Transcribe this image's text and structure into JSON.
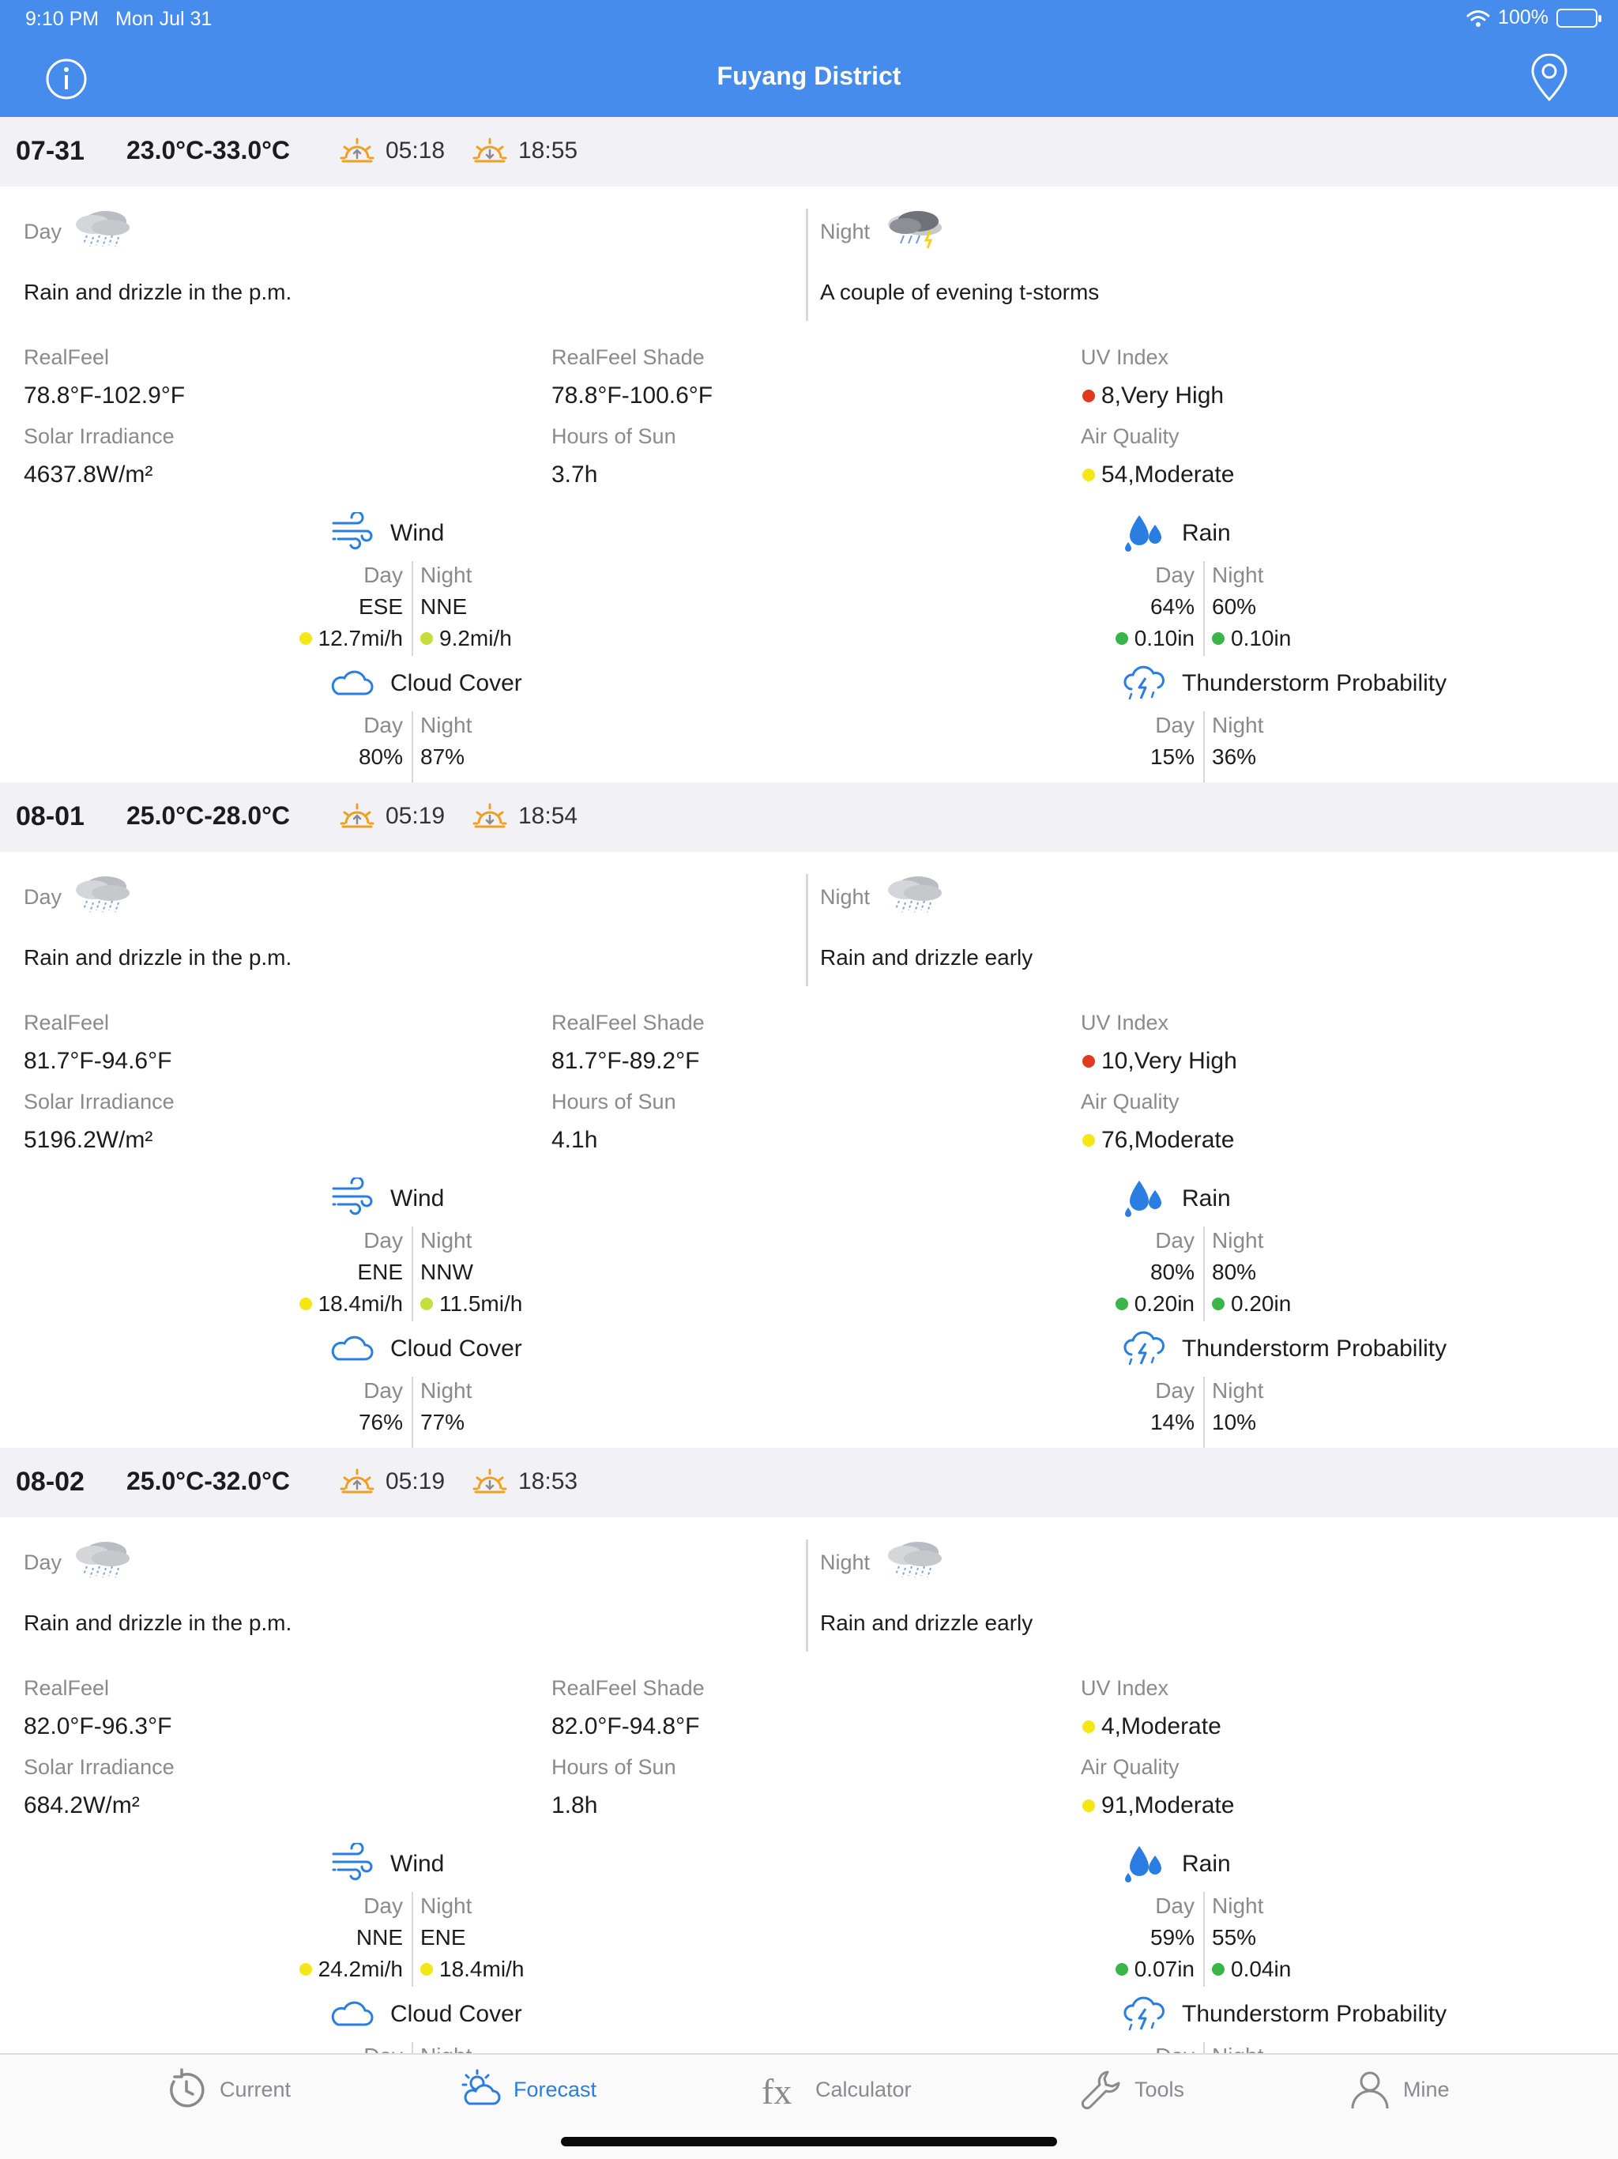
{
  "status_bar": {
    "time": "9:10 PM",
    "date": "Mon Jul 31",
    "battery": "100%"
  },
  "header": {
    "title": "Fuyang District"
  },
  "labels": {
    "day": "Day",
    "night": "Night",
    "realfeel": "RealFeel",
    "realfeel_shade": "RealFeel Shade",
    "uv_index": "UV Index",
    "solar_irradiance": "Solar Irradiance",
    "hours_of_sun": "Hours of Sun",
    "air_quality": "Air Quality",
    "wind": "Wind",
    "rain": "Rain",
    "cloud_cover": "Cloud Cover",
    "thunderstorm": "Thunderstorm Probability"
  },
  "days": [
    {
      "date": "07-31",
      "temp_range": "23.0°C-33.0°C",
      "sunrise": "05:18",
      "sunset": "18:55",
      "day_desc": "Rain and drizzle in the p.m.",
      "night_desc": "A couple of evening t-storms",
      "day_icon": "rain-cloud-icon",
      "night_icon": "thunderstorm-cloud-icon",
      "realfeel": "78.8°F-102.9°F",
      "realfeel_shade": "78.8°F-100.6°F",
      "uv": "8,Very High",
      "uv_color": "#e03a1e",
      "solar": "4637.8W/m²",
      "sun_hours": "3.7h",
      "aq": "54,Moderate",
      "aq_color": "#f5e616",
      "wind": {
        "day_dir": "ESE",
        "night_dir": "NNE",
        "day_speed": "12.7mi/h",
        "night_speed": "9.2mi/h",
        "day_color": "#f5e616",
        "night_color": "#c6dd3c"
      },
      "rain": {
        "day_pct": "64%",
        "night_pct": "60%",
        "day_amt": "0.10in",
        "night_amt": "0.10in"
      },
      "cloud": {
        "day": "80%",
        "night": "87%"
      },
      "thunder": {
        "day": "15%",
        "night": "36%"
      }
    },
    {
      "date": "08-01",
      "temp_range": "25.0°C-28.0°C",
      "sunrise": "05:19",
      "sunset": "18:54",
      "day_desc": "Rain and drizzle in the p.m.",
      "night_desc": "Rain and drizzle early",
      "day_icon": "rain-cloud-icon",
      "night_icon": "rain-cloud-icon",
      "realfeel": "81.7°F-94.6°F",
      "realfeel_shade": "81.7°F-89.2°F",
      "uv": "10,Very High",
      "uv_color": "#e03a1e",
      "solar": "5196.2W/m²",
      "sun_hours": "4.1h",
      "aq": "76,Moderate",
      "aq_color": "#f5e616",
      "wind": {
        "day_dir": "ENE",
        "night_dir": "NNW",
        "day_speed": "18.4mi/h",
        "night_speed": "11.5mi/h",
        "day_color": "#f5e616",
        "night_color": "#c6dd3c"
      },
      "rain": {
        "day_pct": "80%",
        "night_pct": "80%",
        "day_amt": "0.20in",
        "night_amt": "0.20in"
      },
      "cloud": {
        "day": "76%",
        "night": "77%"
      },
      "thunder": {
        "day": "14%",
        "night": "10%"
      }
    },
    {
      "date": "08-02",
      "temp_range": "25.0°C-32.0°C",
      "sunrise": "05:19",
      "sunset": "18:53",
      "day_desc": "Rain and drizzle in the p.m.",
      "night_desc": "Rain and drizzle early",
      "day_icon": "rain-cloud-icon",
      "night_icon": "rain-cloud-icon",
      "realfeel": "82.0°F-96.3°F",
      "realfeel_shade": "82.0°F-94.8°F",
      "uv": "4,Moderate",
      "uv_color": "#f5e616",
      "solar": "684.2W/m²",
      "sun_hours": "1.8h",
      "aq": "91,Moderate",
      "aq_color": "#f5e616",
      "wind": {
        "day_dir": "NNE",
        "night_dir": "ENE",
        "day_speed": "24.2mi/h",
        "night_speed": "18.4mi/h",
        "day_color": "#f5e616",
        "night_color": "#f5e616"
      },
      "rain": {
        "day_pct": "59%",
        "night_pct": "55%",
        "day_amt": "0.07in",
        "night_amt": "0.04in"
      },
      "cloud": {
        "day": "",
        "night": ""
      },
      "thunder": {
        "day": "",
        "night": ""
      }
    }
  ],
  "tabs": [
    {
      "label": "Current",
      "icon": "clock-refresh-icon",
      "active": false
    },
    {
      "label": "Forecast",
      "icon": "sun-cloud-icon",
      "active": true
    },
    {
      "label": "Calculator",
      "icon": "fx-icon",
      "active": false
    },
    {
      "label": "Tools",
      "icon": "wrench-icon",
      "active": false
    },
    {
      "label": "Mine",
      "icon": "person-icon",
      "active": false
    }
  ],
  "colors": {
    "header_bg": "#458ced",
    "accent": "#2a7de1",
    "day_header_bg": "#f2f2f6",
    "rain_good": "#39b54a"
  }
}
